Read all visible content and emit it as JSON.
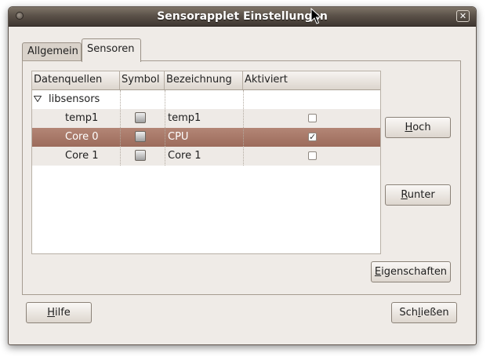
{
  "window": {
    "title": "Sensorapplet Einstellungen",
    "close_glyph": "✕"
  },
  "tabs": [
    {
      "label": "Allgemein",
      "active": false
    },
    {
      "label": "Sensoren",
      "active": true
    }
  ],
  "tree": {
    "columns": [
      "Datenquellen",
      "Symbol",
      "Bezeichnung",
      "Aktiviert"
    ],
    "group": {
      "label": "libsensors",
      "expanded": true
    },
    "rows": [
      {
        "source": "temp1",
        "symbol": "chip-icon",
        "label": "temp1",
        "enabled": false,
        "selected": false
      },
      {
        "source": "Core 0",
        "symbol": "chip-icon",
        "label": "CPU",
        "enabled": true,
        "selected": true
      },
      {
        "source": "Core 1",
        "symbol": "chip-icon",
        "label": "Core 1",
        "enabled": false,
        "selected": false
      }
    ],
    "check_glyph": "✓"
  },
  "buttons": {
    "up": {
      "mnemonic": "H",
      "rest": "och"
    },
    "down": {
      "mnemonic": "R",
      "rest": "unter"
    },
    "properties": {
      "mnemonic": "E",
      "rest": "igenschaften"
    },
    "help": {
      "mnemonic": "H",
      "rest": "ilfe"
    },
    "close": {
      "pre": "Sch",
      "mnemonic": "l",
      "rest": "ießen"
    }
  },
  "colors": {
    "titlebar": "#4a423b",
    "selection": "#a5725f",
    "window_bg": "#efebe7"
  }
}
